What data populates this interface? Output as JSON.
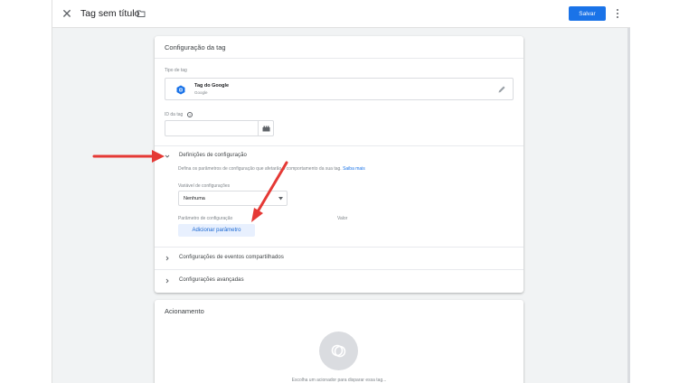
{
  "header": {
    "title": "Tag sem título",
    "save_label": "Salvar"
  },
  "config_card": {
    "title": "Configuração da tag",
    "tag_type_label": "Tipo de tag",
    "tag_type_name": "Tag do Google",
    "tag_type_sub": "Google",
    "tag_id_label": "ID da tag",
    "tag_id_help": "?",
    "tag_id_value": "",
    "sections": {
      "config_settings": {
        "label": "Definições de configuração",
        "description": "Defina os parâmetros de configuração que afetarão o comportamento da sua tag.",
        "learn_more": "Saiba mais",
        "variable_label": "Variável de configurações",
        "variable_value": "Nenhuma",
        "param_label": "Parâmetro de configuração",
        "value_label": "Valor",
        "add_param_label": "Adicionar parâmetro"
      },
      "shared_events": {
        "label": "Configurações de eventos compartilhados"
      },
      "advanced": {
        "label": "Configurações avançadas"
      }
    }
  },
  "trigger_card": {
    "title": "Acionamento",
    "hint": "Escolha um acionador para disparar essa tag..."
  },
  "colors": {
    "accent": "#1a73e8",
    "annotation_arrow": "#e53935",
    "canvas": "#f1f3f4"
  },
  "icons": [
    "close-icon",
    "folder-icon",
    "more-vert-icon",
    "google-tag-icon",
    "pencil-icon",
    "help-icon",
    "variable-brick-icon",
    "chevron-down-icon",
    "chevron-right-icon",
    "caret-down-icon",
    "trigger-icon"
  ]
}
